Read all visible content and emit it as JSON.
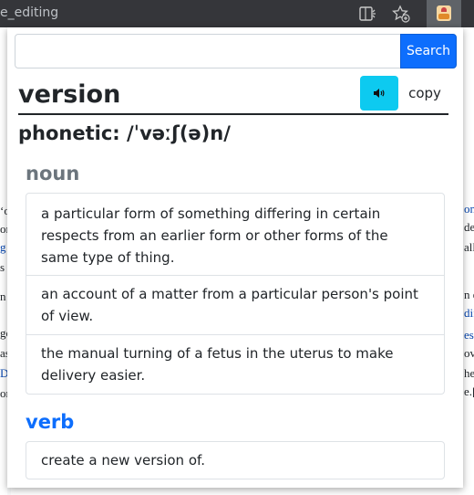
{
  "browser": {
    "url_fragment": "e_editing",
    "icons": [
      "reader-mode-icon",
      "favorites-add-icon",
      "extension-icon"
    ]
  },
  "background_page": {
    "left_fragments": [
      "ʻo",
      "on",
      "g",
      "s a",
      "n",
      "ge",
      "as",
      "D",
      "or"
    ],
    "right_fragments": [
      "on",
      "de",
      "all",
      "n e",
      "dif",
      "es",
      "ov",
      "he",
      "e.["
    ]
  },
  "popup": {
    "search": {
      "value": "",
      "placeholder": "",
      "button_label": "Search"
    },
    "word": "version",
    "audio_button": "speaker-icon",
    "copy_label": "copy",
    "phonetic": "phonetic: /ˈvəːʃ(ə)n/",
    "meanings": [
      {
        "part_of_speech": "noun",
        "definitions": [
          "a particular form of something differing in certain respects from an earlier form or other forms of the same type of thing.",
          "an account of a matter from a particular person's point of view.",
          "the manual turning of a fetus in the uterus to make delivery easier."
        ]
      },
      {
        "part_of_speech": "verb",
        "definitions": [
          "create a new version of."
        ]
      }
    ]
  },
  "colors": {
    "primary": "#0d6efd",
    "info": "#0dcaf0",
    "muted": "#6c757d",
    "chrome": "#35363a"
  }
}
